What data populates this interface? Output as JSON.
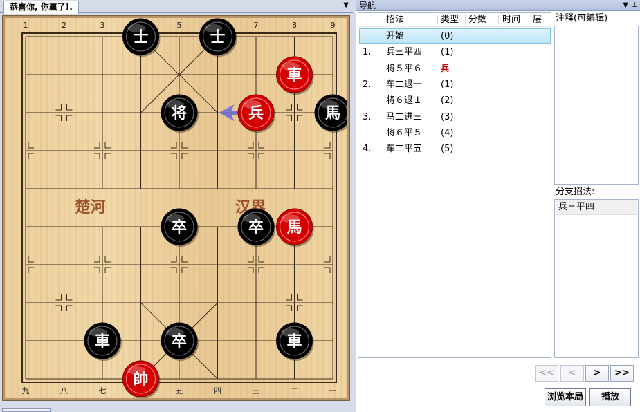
{
  "board_tab": {
    "title": "恭喜你, 你赢了!."
  },
  "board": {
    "top_coords": [
      "1",
      "2",
      "3",
      "4",
      "5",
      "6",
      "7",
      "8",
      "9"
    ],
    "bottom_coords": [
      "九",
      "八",
      "七",
      "六",
      "五",
      "四",
      "三",
      "二",
      "一"
    ],
    "river_left": "楚河",
    "river_right": "汉界",
    "pieces": [
      {
        "label": "士",
        "side": "black",
        "file": 3,
        "rank": 0
      },
      {
        "label": "士",
        "side": "black",
        "file": 5,
        "rank": 0
      },
      {
        "label": "車",
        "side": "red",
        "file": 7,
        "rank": 1
      },
      {
        "label": "将",
        "side": "black",
        "file": 4,
        "rank": 2
      },
      {
        "label": "兵",
        "side": "red",
        "file": 6,
        "rank": 2
      },
      {
        "label": "馬",
        "side": "black",
        "file": 8,
        "rank": 2
      },
      {
        "label": "卒",
        "side": "black",
        "file": 4,
        "rank": 5
      },
      {
        "label": "卒",
        "side": "black",
        "file": 6,
        "rank": 5
      },
      {
        "label": "馬",
        "side": "red",
        "file": 7,
        "rank": 5
      },
      {
        "label": "車",
        "side": "black",
        "file": 2,
        "rank": 8
      },
      {
        "label": "卒",
        "side": "black",
        "file": 4,
        "rank": 8
      },
      {
        "label": "車",
        "side": "black",
        "file": 7,
        "rank": 8
      },
      {
        "label": "帥",
        "side": "red",
        "file": 3,
        "rank": 9
      }
    ],
    "last_move_arrow": {
      "from": [
        6,
        2
      ],
      "to": [
        5,
        2
      ],
      "color": "#6a6ad8"
    }
  },
  "nav": {
    "title": "导航",
    "columns": {
      "move": "招法",
      "type": "类型",
      "score": "分数",
      "time": "时间",
      "depth": "层"
    },
    "moves": [
      {
        "num": "",
        "name": "开始",
        "type": "(0)",
        "selected": true
      },
      {
        "num": "1.",
        "name": "兵三平四",
        "type": "(1)"
      },
      {
        "num": "",
        "name": "将５平６",
        "type": "兵",
        "tag": true
      },
      {
        "num": "2.",
        "name": "车二退一",
        "type": "(1)"
      },
      {
        "num": "",
        "name": "将６退１",
        "type": "(2)"
      },
      {
        "num": "3.",
        "name": "马二进三",
        "type": "(3)"
      },
      {
        "num": "",
        "name": "将６平５",
        "type": "(4)"
      },
      {
        "num": "4.",
        "name": "车二平五",
        "type": "(5)"
      }
    ],
    "comment_label": "注释(可编辑)",
    "branch_label": "分支招法:",
    "branch_items": [
      "兵三平四"
    ],
    "buttons": {
      "first": "<<",
      "prev": "<",
      "next": ">",
      "last": ">>",
      "browse": "浏览本局",
      "play": "播放"
    }
  },
  "colors": {
    "red_piece": "#d40000",
    "black_piece": "#000000",
    "selection": "#bde6f8"
  }
}
